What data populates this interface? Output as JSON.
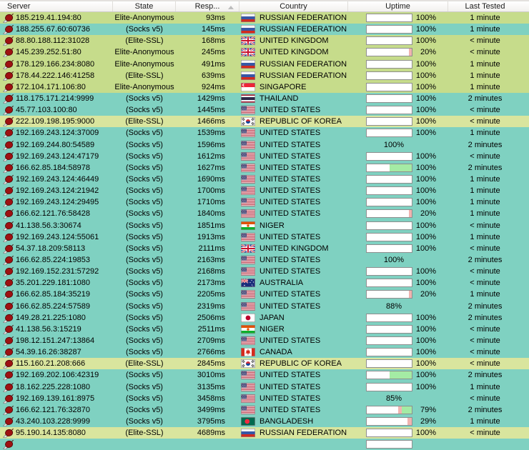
{
  "header": {
    "columns": [
      {
        "id": "server",
        "label": "Server"
      },
      {
        "id": "state",
        "label": "State"
      },
      {
        "id": "resp",
        "label": "Resp...",
        "sort": "ascending"
      },
      {
        "id": "country",
        "label": "Country"
      },
      {
        "id": "uptime",
        "label": "Uptime"
      },
      {
        "id": "last_tested",
        "label": "Last Tested"
      }
    ]
  },
  "colors": {
    "row_green": "#c6dc8b",
    "row_green_light": "#d9e59e",
    "row_teal": "#7fd1c1",
    "bar_up": "#a4eba4",
    "bar_down": "#f0b4b0",
    "bar_bg": "#ffffff",
    "bar_border": "#8e8e8e"
  },
  "rows": [
    {
      "server": "185.219.41.194:80",
      "state": "Elite-Anonymous",
      "resp": "93ms",
      "country": "RUSSIAN FEDERATION",
      "cc": "ru",
      "uptime": "100%",
      "bar": true,
      "tested": "1 minute",
      "bg": "g1"
    },
    {
      "server": "188.255.67.60:60736",
      "state": "(Socks v5)",
      "resp": "145ms",
      "country": "RUSSIAN FEDERATION",
      "cc": "ru",
      "uptime": "100%",
      "bar": true,
      "tested": "1 minute",
      "bg": "t"
    },
    {
      "server": "88.80.188.112:31028",
      "state": "(Elite-SSL)",
      "resp": "168ms",
      "country": "UNITED KINGDOM",
      "cc": "gb",
      "uptime": "100%",
      "bar": true,
      "tested": "< minute",
      "bg": "g1"
    },
    {
      "server": "145.239.252.51:80",
      "state": "Elite-Anonymous",
      "resp": "245ms",
      "country": "UNITED KINGDOM",
      "cc": "gb",
      "uptime": "20%",
      "bar": true,
      "segs": [
        [
          "w",
          93
        ],
        [
          "p",
          7
        ]
      ],
      "tested": "< minute",
      "bg": "g1"
    },
    {
      "server": "178.129.166.234:8080",
      "state": "Elite-Anonymous",
      "resp": "491ms",
      "country": "RUSSIAN FEDERATION",
      "cc": "ru",
      "uptime": "100%",
      "bar": true,
      "tested": "1 minute",
      "bg": "g1"
    },
    {
      "server": "178.44.222.146:41258",
      "state": "(Elite-SSL)",
      "resp": "639ms",
      "country": "RUSSIAN FEDERATION",
      "cc": "ru",
      "uptime": "100%",
      "bar": true,
      "tested": "1 minute",
      "bg": "g1"
    },
    {
      "server": "172.104.171.106:80",
      "state": "Elite-Anonymous",
      "resp": "924ms",
      "country": "SINGAPORE",
      "cc": "sg",
      "uptime": "100%",
      "bar": true,
      "tested": "1 minute",
      "bg": "g1"
    },
    {
      "server": "118.175.171.214:9999",
      "state": "(Socks v5)",
      "resp": "1429ms",
      "country": "THAILAND",
      "cc": "th",
      "uptime": "100%",
      "bar": true,
      "tested": "2 minutes",
      "bg": "t"
    },
    {
      "server": "45.77.103.100:80",
      "state": "(Socks v5)",
      "resp": "1445ms",
      "country": "UNITED STATES",
      "cc": "us",
      "uptime": "100%",
      "bar": true,
      "tested": "< minute",
      "bg": "t"
    },
    {
      "server": "222.109.198.195:9000",
      "state": "(Elite-SSL)",
      "resp": "1466ms",
      "country": "REPUBLIC OF KOREA",
      "cc": "kr",
      "uptime": "100%",
      "bar": true,
      "tested": "< minute",
      "bg": "g2"
    },
    {
      "server": "192.169.243.124:37009",
      "state": "(Socks v5)",
      "resp": "1539ms",
      "country": "UNITED STATES",
      "cc": "us",
      "uptime": "100%",
      "bar": true,
      "tested": "1 minute",
      "bg": "t"
    },
    {
      "server": "192.169.244.80:54589",
      "state": "(Socks v5)",
      "resp": "1596ms",
      "country": "UNITED STATES",
      "cc": "us",
      "uptime": "100%",
      "bar": false,
      "tested": "2 minutes",
      "bg": "t"
    },
    {
      "server": "192.169.243.124:47179",
      "state": "(Socks v5)",
      "resp": "1612ms",
      "country": "UNITED STATES",
      "cc": "us",
      "uptime": "100%",
      "bar": true,
      "tested": "< minute",
      "bg": "t"
    },
    {
      "server": "166.62.85.184:58978",
      "state": "(Socks v5)",
      "resp": "1627ms",
      "country": "UNITED STATES",
      "cc": "us",
      "uptime": "100%",
      "bar": true,
      "segs": [
        [
          "w",
          51
        ],
        [
          "g",
          49
        ]
      ],
      "tested": "2 minutes",
      "bg": "t"
    },
    {
      "server": "192.169.243.124:46449",
      "state": "(Socks v5)",
      "resp": "1690ms",
      "country": "UNITED STATES",
      "cc": "us",
      "uptime": "100%",
      "bar": true,
      "tested": "1 minute",
      "bg": "t"
    },
    {
      "server": "192.169.243.124:21942",
      "state": "(Socks v5)",
      "resp": "1700ms",
      "country": "UNITED STATES",
      "cc": "us",
      "uptime": "100%",
      "bar": true,
      "tested": "1 minute",
      "bg": "t"
    },
    {
      "server": "192.169.243.124:29495",
      "state": "(Socks v5)",
      "resp": "1710ms",
      "country": "UNITED STATES",
      "cc": "us",
      "uptime": "100%",
      "bar": true,
      "tested": "1 minute",
      "bg": "t"
    },
    {
      "server": "166.62.121.76:58428",
      "state": "(Socks v5)",
      "resp": "1840ms",
      "country": "UNITED STATES",
      "cc": "us",
      "uptime": "20%",
      "bar": true,
      "segs": [
        [
          "w",
          93
        ],
        [
          "p",
          7
        ]
      ],
      "tested": "1 minute",
      "bg": "t"
    },
    {
      "server": "41.138.56.3:30674",
      "state": "(Socks v5)",
      "resp": "1851ms",
      "country": "NIGER",
      "cc": "ne",
      "uptime": "100%",
      "bar": true,
      "tested": "< minute",
      "bg": "t"
    },
    {
      "server": "192.169.243.124:55061",
      "state": "(Socks v5)",
      "resp": "1913ms",
      "country": "UNITED STATES",
      "cc": "us",
      "uptime": "100%",
      "bar": true,
      "tested": "1 minute",
      "bg": "t"
    },
    {
      "server": "54.37.18.209:58113",
      "state": "(Socks v5)",
      "resp": "2111ms",
      "country": "UNITED KINGDOM",
      "cc": "gb",
      "uptime": "100%",
      "bar": true,
      "tested": "< minute",
      "bg": "t"
    },
    {
      "server": "166.62.85.224:19853",
      "state": "(Socks v5)",
      "resp": "2163ms",
      "country": "UNITED STATES",
      "cc": "us",
      "uptime": "100%",
      "bar": false,
      "tested": "2 minutes",
      "bg": "t"
    },
    {
      "server": "192.169.152.231:57292",
      "state": "(Socks v5)",
      "resp": "2168ms",
      "country": "UNITED STATES",
      "cc": "us",
      "uptime": "100%",
      "bar": true,
      "tested": "< minute",
      "bg": "t"
    },
    {
      "server": "35.201.229.181:1080",
      "state": "(Socks v5)",
      "resp": "2173ms",
      "country": "AUSTRALIA",
      "cc": "au",
      "uptime": "100%",
      "bar": true,
      "tested": "< minute",
      "bg": "t"
    },
    {
      "server": "166.62.85.184:35219",
      "state": "(Socks v5)",
      "resp": "2205ms",
      "country": "UNITED STATES",
      "cc": "us",
      "uptime": "20%",
      "bar": true,
      "segs": [
        [
          "w",
          93
        ],
        [
          "p",
          7
        ]
      ],
      "tested": "1 minute",
      "bg": "t"
    },
    {
      "server": "166.62.85.224:57589",
      "state": "(Socks v5)",
      "resp": "2319ms",
      "country": "UNITED STATES",
      "cc": "us",
      "uptime": "88%",
      "bar": false,
      "tested": "2 minutes",
      "bg": "t"
    },
    {
      "server": "149.28.21.225:1080",
      "state": "(Socks v5)",
      "resp": "2506ms",
      "country": "JAPAN",
      "cc": "jp",
      "uptime": "100%",
      "bar": true,
      "tested": "2 minutes",
      "bg": "t"
    },
    {
      "server": "41.138.56.3:15219",
      "state": "(Socks v5)",
      "resp": "2511ms",
      "country": "NIGER",
      "cc": "ne",
      "uptime": "100%",
      "bar": true,
      "tested": "< minute",
      "bg": "t"
    },
    {
      "server": "198.12.151.247:13864",
      "state": "(Socks v5)",
      "resp": "2709ms",
      "country": "UNITED STATES",
      "cc": "us",
      "uptime": "100%",
      "bar": true,
      "tested": "< minute",
      "bg": "t"
    },
    {
      "server": "54.39.16.26:38287",
      "state": "(Socks v5)",
      "resp": "2766ms",
      "country": "CANADA",
      "cc": "ca",
      "uptime": "100%",
      "bar": true,
      "tested": "< minute",
      "bg": "t"
    },
    {
      "server": "115.160.21.208:666",
      "state": "(Elite-SSL)",
      "resp": "2845ms",
      "country": "REPUBLIC OF KOREA",
      "cc": "kr",
      "uptime": "100%",
      "bar": true,
      "tested": "< minute",
      "bg": "g2"
    },
    {
      "server": "192.169.202.106:42319",
      "state": "(Socks v5)",
      "resp": "3010ms",
      "country": "UNITED STATES",
      "cc": "us",
      "uptime": "100%",
      "bar": true,
      "segs": [
        [
          "w",
          51
        ],
        [
          "g",
          49
        ]
      ],
      "tested": "2 minutes",
      "bg": "t"
    },
    {
      "server": "18.162.225.228:1080",
      "state": "(Socks v5)",
      "resp": "3135ms",
      "country": "UNITED STATES",
      "cc": "us",
      "uptime": "100%",
      "bar": true,
      "tested": "1 minute",
      "bg": "t"
    },
    {
      "server": "192.169.139.161:8975",
      "state": "(Socks v5)",
      "resp": "3458ms",
      "country": "UNITED STATES",
      "cc": "us",
      "uptime": "85%",
      "bar": false,
      "tested": "< minute",
      "bg": "t"
    },
    {
      "server": "166.62.121.76:32870",
      "state": "(Socks v5)",
      "resp": "3499ms",
      "country": "UNITED STATES",
      "cc": "us",
      "uptime": "79%",
      "bar": true,
      "segs": [
        [
          "w",
          70
        ],
        [
          "p",
          8
        ],
        [
          "g",
          22
        ]
      ],
      "tested": "2 minutes",
      "bg": "t"
    },
    {
      "server": "43.240.103.228:9999",
      "state": "(Socks v5)",
      "resp": "3795ms",
      "country": "BANGLADESH",
      "cc": "bd",
      "uptime": "29%",
      "bar": true,
      "segs": [
        [
          "w",
          91
        ],
        [
          "p",
          9
        ]
      ],
      "tested": "1 minute",
      "bg": "t"
    },
    {
      "server": "95.190.14.135:8080",
      "state": "(Elite-SSL)",
      "resp": "4689ms",
      "country": "RUSSIAN FEDERATION",
      "cc": "ru",
      "uptime": "100%",
      "bar": true,
      "tested": "< minute",
      "bg": "g2"
    },
    {
      "server": "",
      "state": "",
      "resp": "",
      "country": "",
      "cc": "",
      "uptime": "",
      "bar": true,
      "tested": "",
      "bg": "t",
      "partial": true
    }
  ]
}
